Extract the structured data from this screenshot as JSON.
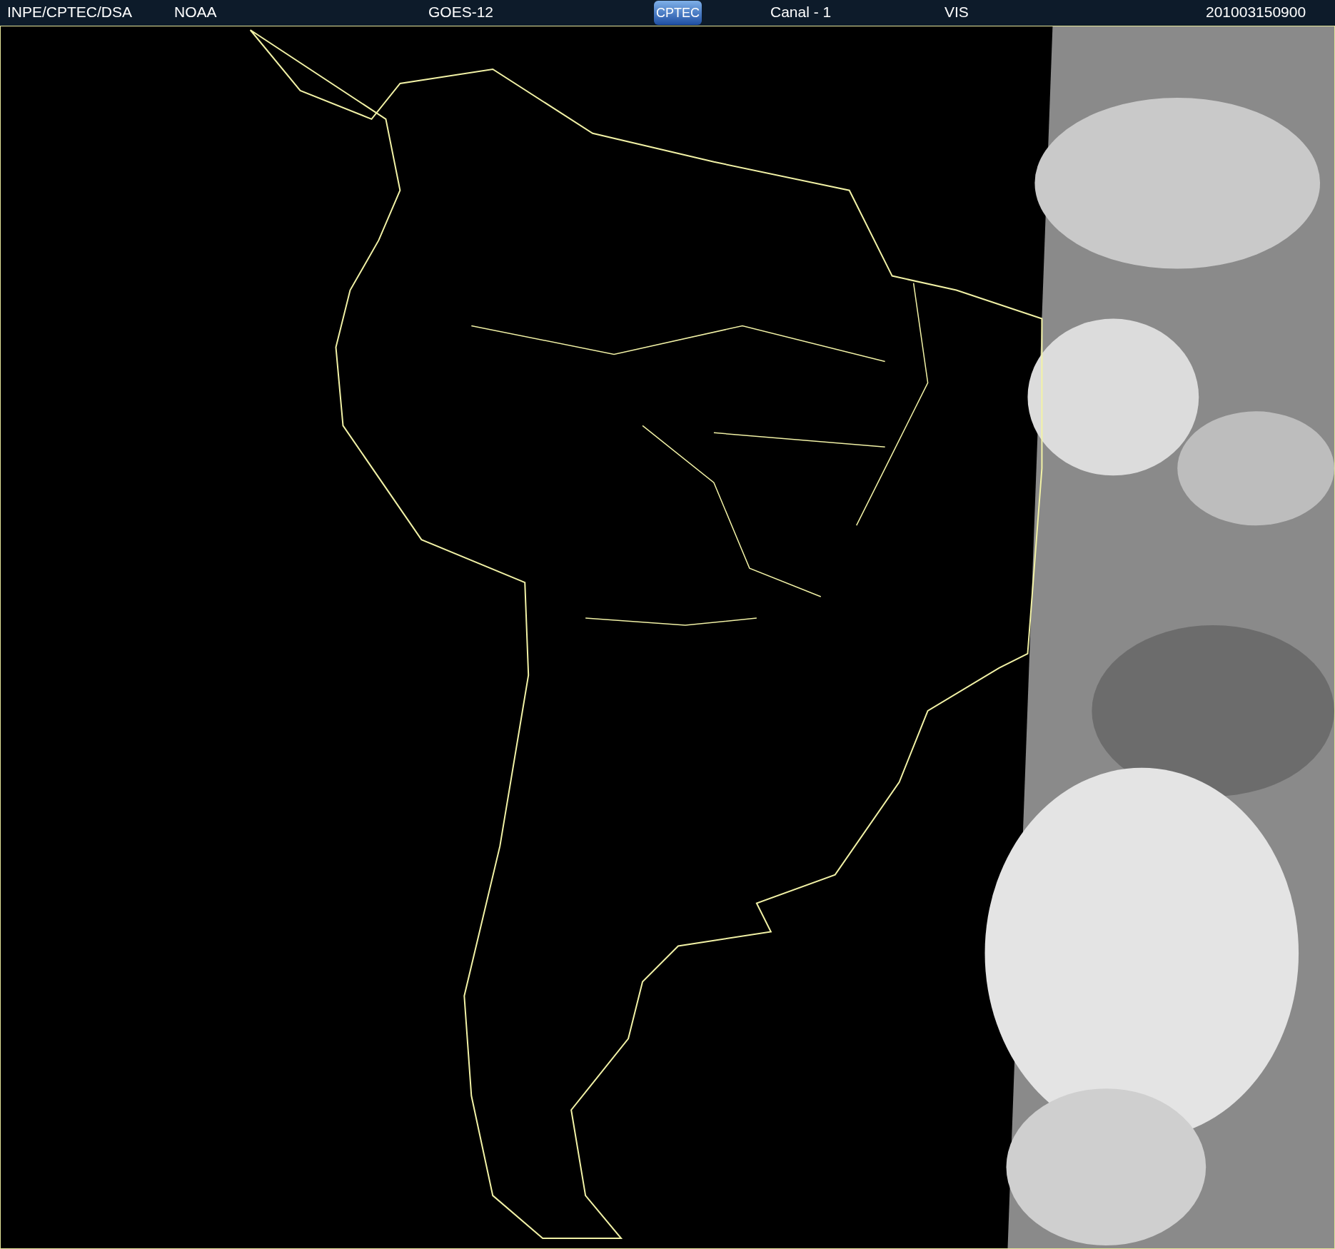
{
  "header": {
    "source": "INPE/CPTEC/DSA",
    "agency": "NOAA",
    "satellite": "GOES-12",
    "logo": "CPTEC",
    "channel": "Canal - 1",
    "band": "VIS",
    "timestamp": "201003150900"
  }
}
